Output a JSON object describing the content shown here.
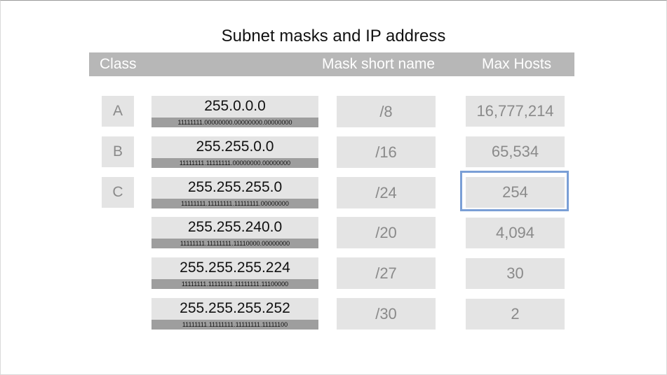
{
  "title": "Subnet masks and IP address",
  "headers": {
    "class": "Class",
    "mask_short": "Mask short name",
    "max_hosts": "Max Hosts"
  },
  "classes": [
    "A",
    "B",
    "C"
  ],
  "rows": [
    {
      "mask": "255.0.0.0",
      "binary": "11111111.00000000.00000000.00000000",
      "short": "/8",
      "hosts": "16,777,214"
    },
    {
      "mask": "255.255.0.0",
      "binary": "11111111.11111111.00000000.00000000",
      "short": "/16",
      "hosts": "65,534"
    },
    {
      "mask": "255.255.255.0",
      "binary": "11111111.11111111.11111111.00000000",
      "short": "/24",
      "hosts": "254"
    },
    {
      "mask": "255.255.240.0",
      "binary": "11111111.11111111.11110000.00000000",
      "short": "/20",
      "hosts": "4,094"
    },
    {
      "mask": "255.255.255.224",
      "binary": "11111111.11111111.11111111.11100000",
      "short": "/27",
      "hosts": "30"
    },
    {
      "mask": "255.255.255.252",
      "binary": "11111111.11111111.11111111.11111100",
      "short": "/30",
      "hosts": "2"
    }
  ],
  "colors": {
    "header_bg": "#b7b7b7",
    "cell_bg": "#e4e4e4",
    "binary_bg": "#9e9e9e",
    "highlight": "#7a9fd6"
  }
}
